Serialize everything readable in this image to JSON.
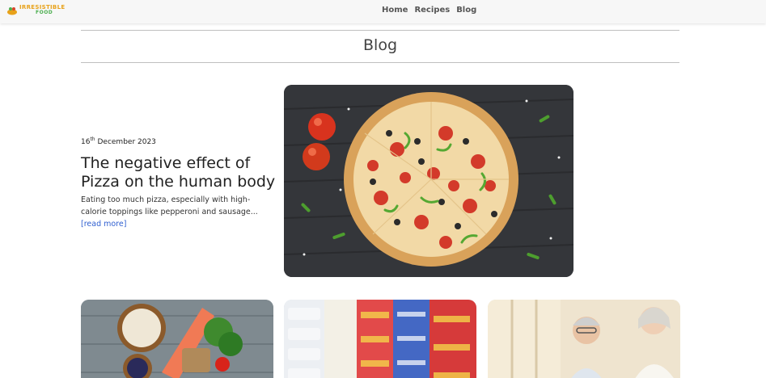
{
  "logo": {
    "line1": "IRRESISTIBLE",
    "line2": "FOOD"
  },
  "nav": {
    "links": [
      {
        "label": "Home"
      },
      {
        "label": "Recipes"
      },
      {
        "label": "Blog"
      }
    ]
  },
  "page": {
    "title": "Blog"
  },
  "featured": {
    "date_day": "16",
    "date_suffix": "th",
    "date_rest": " December 2023",
    "title": "The negative effect of Pizza on the human body",
    "excerpt": "Eating too much pizza, especially with high-calorie toppings like pepperoni and sausage...",
    "read_more": "[read more]"
  },
  "colors": {
    "link": "#2f5fd0",
    "logo_orange": "#e8a21a",
    "logo_green": "#4caf50"
  }
}
